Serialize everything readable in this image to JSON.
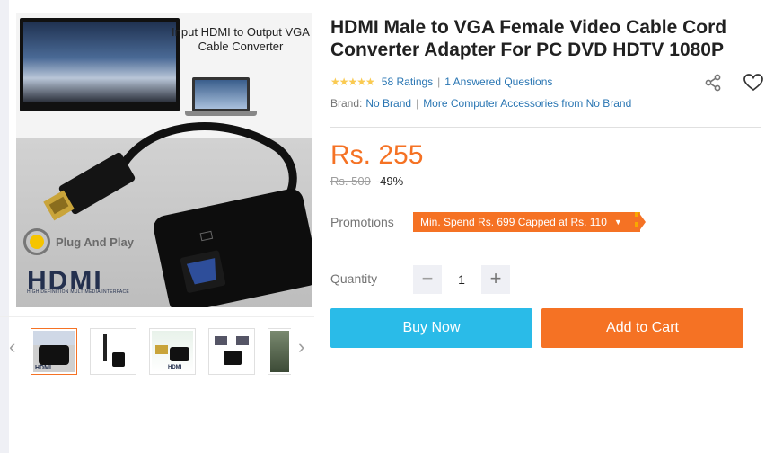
{
  "product": {
    "title": "HDMI Male to VGA Female Video Cable Cord Converter Adapter For PC DVD HDTV 1080P",
    "rating_stars": "★★★★★",
    "ratings_text": "58 Ratings",
    "answered_text": "1 Answered Questions",
    "brand_label": "Brand:",
    "brand_value": "No Brand",
    "more_from": "More Computer Accessories from No Brand"
  },
  "image": {
    "caption": "Input HDMI to Output VGA Cable Converter",
    "plug_text": "Plug And Play",
    "logo_text": "HDMI",
    "logo_sub": "HIGH DEFINITION MULTIMEDIA INTERFACE"
  },
  "thumbnails": {
    "prev_arrow": "‹",
    "next_arrow": "›",
    "thumb_logo": "HDMI"
  },
  "pricing": {
    "price": "Rs. 255",
    "old_price": "Rs. 500",
    "discount": "-49%"
  },
  "promotions": {
    "label": "Promotions",
    "tag": "Min. Spend Rs. 699 Capped at Rs. 110",
    "caret": "▼"
  },
  "quantity": {
    "label": "Quantity",
    "value": "1",
    "minus": "−",
    "plus": "+"
  },
  "actions": {
    "buy_now": "Buy Now",
    "add_to_cart": "Add to Cart"
  },
  "colors": {
    "accent": "#f57224",
    "buy": "#2abbe8",
    "link": "#2a76b3",
    "star": "#faca51"
  },
  "icons": [
    "share-icon",
    "heart-icon",
    "chevron-left-icon",
    "chevron-right-icon",
    "minus-icon",
    "plus-icon"
  ]
}
